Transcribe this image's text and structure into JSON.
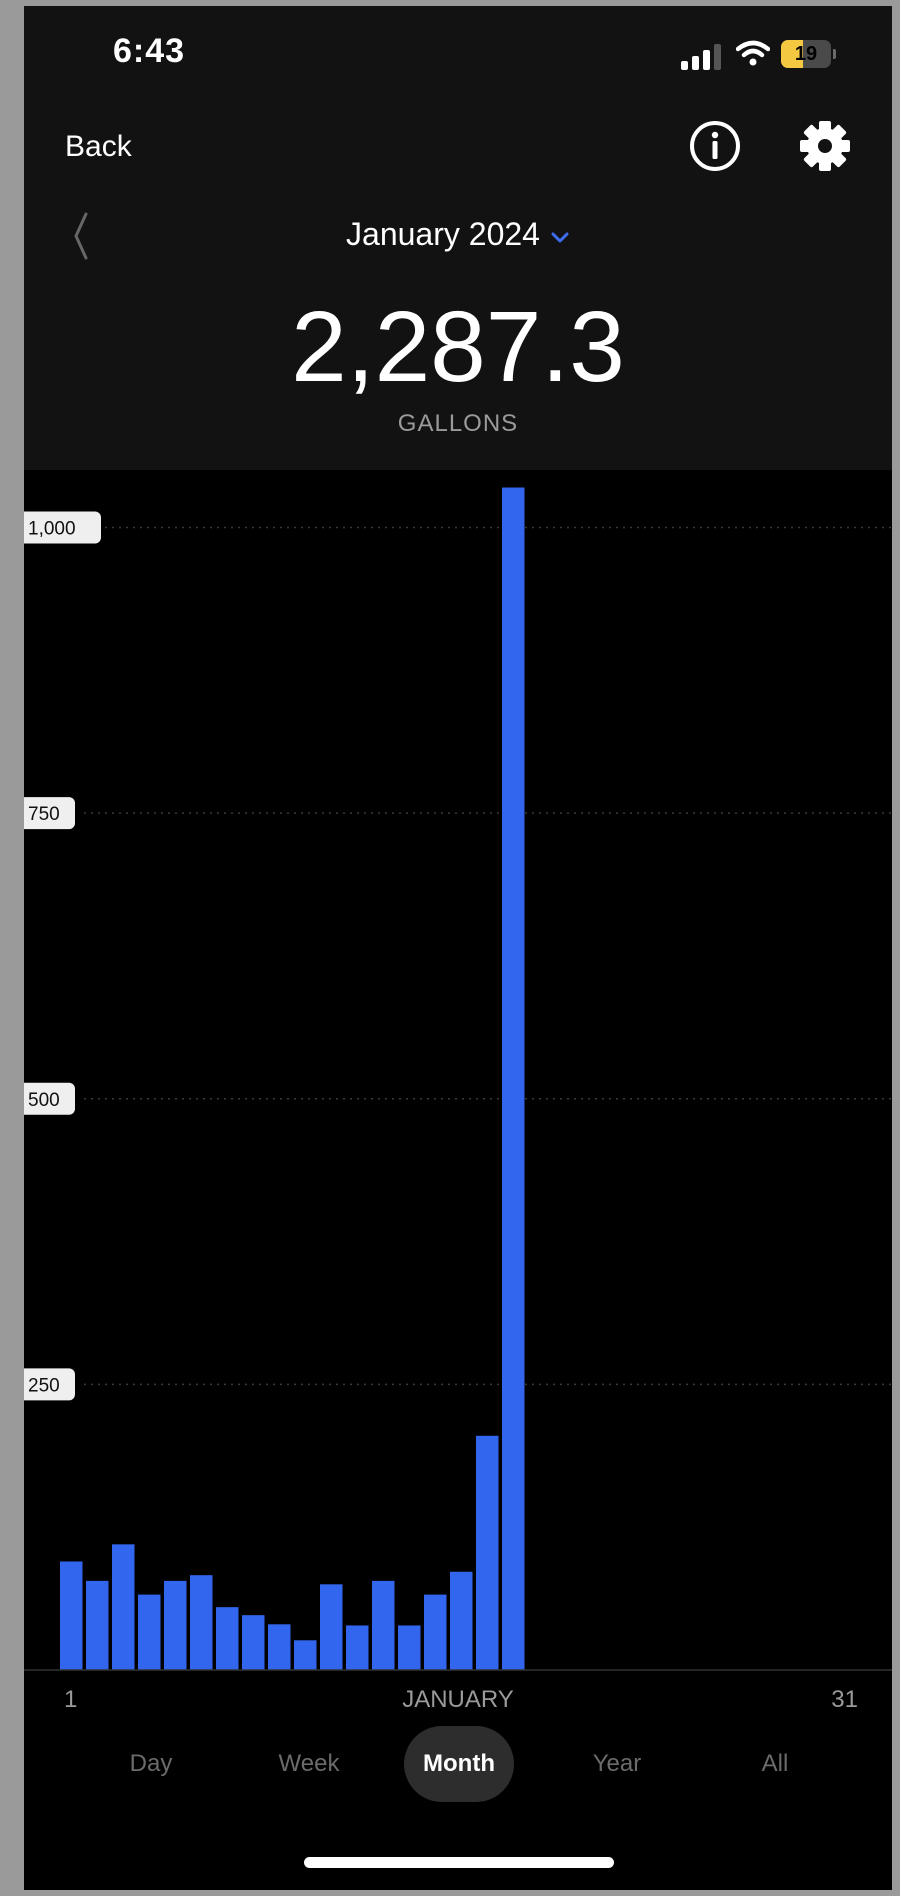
{
  "status_bar": {
    "time": "6:43",
    "battery": "19"
  },
  "nav": {
    "back_label": "Back",
    "info_icon": "info-icon",
    "settings_icon": "gear-icon"
  },
  "period": {
    "label": "January 2024"
  },
  "summary": {
    "total": "2,287.3",
    "unit": "GALLONS"
  },
  "colors": {
    "accent": "#3366ee",
    "background": "#000000",
    "header": "#121212"
  },
  "chart_data": {
    "type": "bar",
    "x": [
      1,
      2,
      3,
      4,
      5,
      6,
      7,
      8,
      9,
      10,
      11,
      12,
      13,
      14,
      15,
      16,
      17,
      18
    ],
    "values": [
      95,
      78,
      110,
      66,
      78,
      83,
      55,
      48,
      40,
      26,
      75,
      39,
      78,
      39,
      66,
      86,
      205,
      1035
    ],
    "ylim": [
      0,
      1070
    ],
    "yticks": [
      250,
      500,
      750,
      1000
    ],
    "ytick_labels": [
      "250",
      "500",
      "750",
      "1,000"
    ],
    "x_start_label": "1",
    "x_center_label": "JANUARY",
    "x_end_label": "31",
    "grid": true
  },
  "tabs": [
    {
      "label": "Day",
      "active": false
    },
    {
      "label": "Week",
      "active": false
    },
    {
      "label": "Month",
      "active": true
    },
    {
      "label": "Year",
      "active": false
    },
    {
      "label": "All",
      "active": false
    }
  ]
}
